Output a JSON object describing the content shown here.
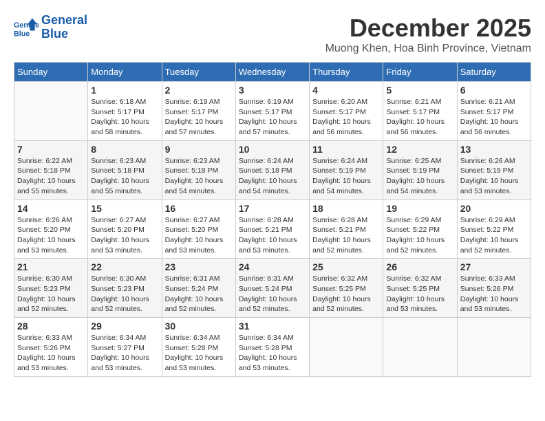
{
  "app": {
    "logo_line1": "General",
    "logo_line2": "Blue"
  },
  "header": {
    "month": "December 2025",
    "location": "Muong Khen, Hoa Binh Province, Vietnam"
  },
  "weekdays": [
    "Sunday",
    "Monday",
    "Tuesday",
    "Wednesday",
    "Thursday",
    "Friday",
    "Saturday"
  ],
  "weeks": [
    [
      {
        "day": "",
        "sunrise": "",
        "sunset": "",
        "daylight": ""
      },
      {
        "day": "1",
        "sunrise": "Sunrise: 6:18 AM",
        "sunset": "Sunset: 5:17 PM",
        "daylight": "Daylight: 10 hours and 58 minutes."
      },
      {
        "day": "2",
        "sunrise": "Sunrise: 6:19 AM",
        "sunset": "Sunset: 5:17 PM",
        "daylight": "Daylight: 10 hours and 57 minutes."
      },
      {
        "day": "3",
        "sunrise": "Sunrise: 6:19 AM",
        "sunset": "Sunset: 5:17 PM",
        "daylight": "Daylight: 10 hours and 57 minutes."
      },
      {
        "day": "4",
        "sunrise": "Sunrise: 6:20 AM",
        "sunset": "Sunset: 5:17 PM",
        "daylight": "Daylight: 10 hours and 56 minutes."
      },
      {
        "day": "5",
        "sunrise": "Sunrise: 6:21 AM",
        "sunset": "Sunset: 5:17 PM",
        "daylight": "Daylight: 10 hours and 56 minutes."
      },
      {
        "day": "6",
        "sunrise": "Sunrise: 6:21 AM",
        "sunset": "Sunset: 5:17 PM",
        "daylight": "Daylight: 10 hours and 56 minutes."
      }
    ],
    [
      {
        "day": "7",
        "sunrise": "Sunrise: 6:22 AM",
        "sunset": "Sunset: 5:18 PM",
        "daylight": "Daylight: 10 hours and 55 minutes."
      },
      {
        "day": "8",
        "sunrise": "Sunrise: 6:23 AM",
        "sunset": "Sunset: 5:18 PM",
        "daylight": "Daylight: 10 hours and 55 minutes."
      },
      {
        "day": "9",
        "sunrise": "Sunrise: 6:23 AM",
        "sunset": "Sunset: 5:18 PM",
        "daylight": "Daylight: 10 hours and 54 minutes."
      },
      {
        "day": "10",
        "sunrise": "Sunrise: 6:24 AM",
        "sunset": "Sunset: 5:18 PM",
        "daylight": "Daylight: 10 hours and 54 minutes."
      },
      {
        "day": "11",
        "sunrise": "Sunrise: 6:24 AM",
        "sunset": "Sunset: 5:19 PM",
        "daylight": "Daylight: 10 hours and 54 minutes."
      },
      {
        "day": "12",
        "sunrise": "Sunrise: 6:25 AM",
        "sunset": "Sunset: 5:19 PM",
        "daylight": "Daylight: 10 hours and 54 minutes."
      },
      {
        "day": "13",
        "sunrise": "Sunrise: 6:26 AM",
        "sunset": "Sunset: 5:19 PM",
        "daylight": "Daylight: 10 hours and 53 minutes."
      }
    ],
    [
      {
        "day": "14",
        "sunrise": "Sunrise: 6:26 AM",
        "sunset": "Sunset: 5:20 PM",
        "daylight": "Daylight: 10 hours and 53 minutes."
      },
      {
        "day": "15",
        "sunrise": "Sunrise: 6:27 AM",
        "sunset": "Sunset: 5:20 PM",
        "daylight": "Daylight: 10 hours and 53 minutes."
      },
      {
        "day": "16",
        "sunrise": "Sunrise: 6:27 AM",
        "sunset": "Sunset: 5:20 PM",
        "daylight": "Daylight: 10 hours and 53 minutes."
      },
      {
        "day": "17",
        "sunrise": "Sunrise: 6:28 AM",
        "sunset": "Sunset: 5:21 PM",
        "daylight": "Daylight: 10 hours and 53 minutes."
      },
      {
        "day": "18",
        "sunrise": "Sunrise: 6:28 AM",
        "sunset": "Sunset: 5:21 PM",
        "daylight": "Daylight: 10 hours and 52 minutes."
      },
      {
        "day": "19",
        "sunrise": "Sunrise: 6:29 AM",
        "sunset": "Sunset: 5:22 PM",
        "daylight": "Daylight: 10 hours and 52 minutes."
      },
      {
        "day": "20",
        "sunrise": "Sunrise: 6:29 AM",
        "sunset": "Sunset: 5:22 PM",
        "daylight": "Daylight: 10 hours and 52 minutes."
      }
    ],
    [
      {
        "day": "21",
        "sunrise": "Sunrise: 6:30 AM",
        "sunset": "Sunset: 5:23 PM",
        "daylight": "Daylight: 10 hours and 52 minutes."
      },
      {
        "day": "22",
        "sunrise": "Sunrise: 6:30 AM",
        "sunset": "Sunset: 5:23 PM",
        "daylight": "Daylight: 10 hours and 52 minutes."
      },
      {
        "day": "23",
        "sunrise": "Sunrise: 6:31 AM",
        "sunset": "Sunset: 5:24 PM",
        "daylight": "Daylight: 10 hours and 52 minutes."
      },
      {
        "day": "24",
        "sunrise": "Sunrise: 6:31 AM",
        "sunset": "Sunset: 5:24 PM",
        "daylight": "Daylight: 10 hours and 52 minutes."
      },
      {
        "day": "25",
        "sunrise": "Sunrise: 6:32 AM",
        "sunset": "Sunset: 5:25 PM",
        "daylight": "Daylight: 10 hours and 52 minutes."
      },
      {
        "day": "26",
        "sunrise": "Sunrise: 6:32 AM",
        "sunset": "Sunset: 5:25 PM",
        "daylight": "Daylight: 10 hours and 53 minutes."
      },
      {
        "day": "27",
        "sunrise": "Sunrise: 6:33 AM",
        "sunset": "Sunset: 5:26 PM",
        "daylight": "Daylight: 10 hours and 53 minutes."
      }
    ],
    [
      {
        "day": "28",
        "sunrise": "Sunrise: 6:33 AM",
        "sunset": "Sunset: 5:26 PM",
        "daylight": "Daylight: 10 hours and 53 minutes."
      },
      {
        "day": "29",
        "sunrise": "Sunrise: 6:34 AM",
        "sunset": "Sunset: 5:27 PM",
        "daylight": "Daylight: 10 hours and 53 minutes."
      },
      {
        "day": "30",
        "sunrise": "Sunrise: 6:34 AM",
        "sunset": "Sunset: 5:28 PM",
        "daylight": "Daylight: 10 hours and 53 minutes."
      },
      {
        "day": "31",
        "sunrise": "Sunrise: 6:34 AM",
        "sunset": "Sunset: 5:28 PM",
        "daylight": "Daylight: 10 hours and 53 minutes."
      },
      {
        "day": "",
        "sunrise": "",
        "sunset": "",
        "daylight": ""
      },
      {
        "day": "",
        "sunrise": "",
        "sunset": "",
        "daylight": ""
      },
      {
        "day": "",
        "sunrise": "",
        "sunset": "",
        "daylight": ""
      }
    ]
  ]
}
